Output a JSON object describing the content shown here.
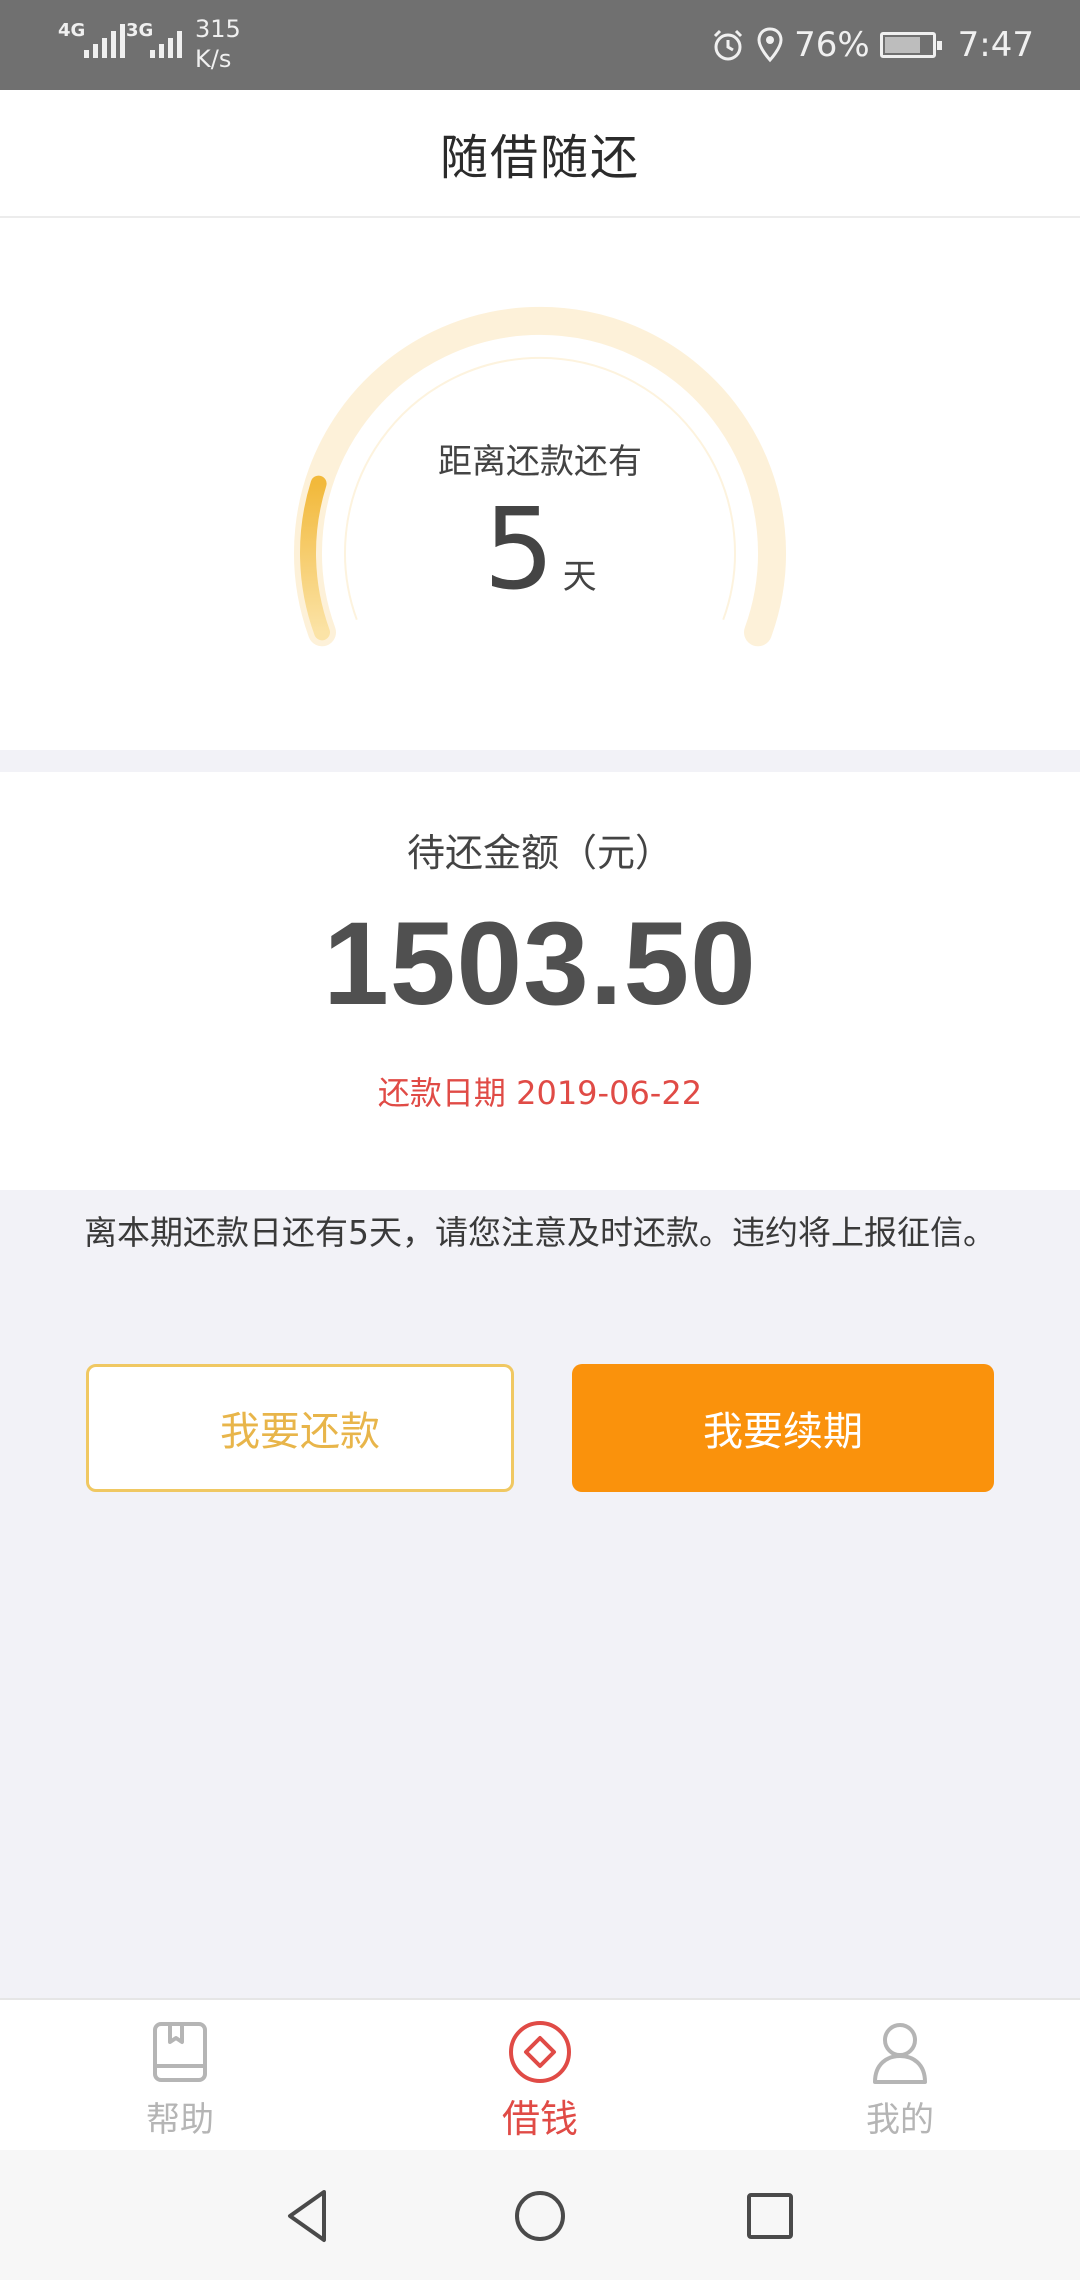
{
  "status_bar": {
    "network1": "4G",
    "network2": "3G",
    "speed_value": "315",
    "speed_unit": "K/s",
    "battery_percent": "76%",
    "battery_level": 0.76,
    "time": "7:47",
    "icons": [
      "signal-icon",
      "alarm-icon",
      "location-icon",
      "battery-icon"
    ]
  },
  "header": {
    "title": "随借随还"
  },
  "gauge": {
    "label": "距离还款还有",
    "days": "5",
    "unit": "天",
    "progress": 0.17,
    "track_color": "#fdf1d9",
    "progress_color": "#f2b93b"
  },
  "amount": {
    "label": "待还金额（元）",
    "value": "1503.50",
    "due_date_text": "还款日期 2019-06-22"
  },
  "notice": "离本期还款日还有5天，请您注意及时还款。违约将上报征信。",
  "buttons": {
    "repay": "我要还款",
    "renew": "我要续期"
  },
  "tabs": [
    {
      "label": "帮助",
      "icon": "book-icon",
      "active": false
    },
    {
      "label": "借钱",
      "icon": "diamond-icon",
      "active": true
    },
    {
      "label": "我的",
      "icon": "user-icon",
      "active": false
    }
  ],
  "colors": {
    "accent": "#fa920c",
    "alert": "#e04b46",
    "gold": "#f0c862"
  },
  "nav": [
    "back-icon",
    "home-icon",
    "recents-icon"
  ]
}
